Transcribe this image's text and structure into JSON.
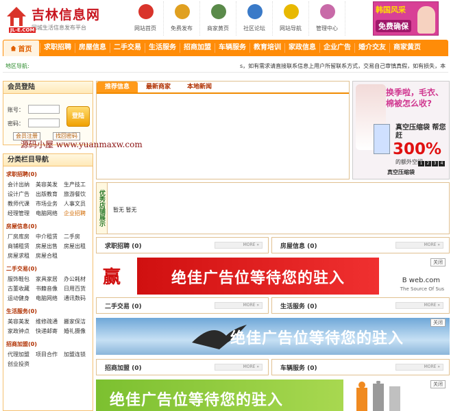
{
  "logo": {
    "title": "吉林信息网",
    "slogan": "同城生活信息发布平台",
    "domain": "JL-E.COM"
  },
  "topnav": [
    {
      "label": "网站首页",
      "icon": "house-icon",
      "color": "#d9342b"
    },
    {
      "label": "免费发布",
      "icon": "document-icon",
      "color": "#e0a020"
    },
    {
      "label": "商家黄页",
      "icon": "id-card-icon",
      "color": "#5a8a4a"
    },
    {
      "label": "社区论坛",
      "icon": "people-icon",
      "color": "#3a7ac8"
    },
    {
      "label": "网站导航",
      "icon": "star-icon",
      "color": "#e8b800"
    },
    {
      "label": "管理中心",
      "icon": "users-icon",
      "color": "#c86aa8"
    }
  ],
  "ad_top": {
    "line1": "韩国风采",
    "line2": "免费确保"
  },
  "nav": {
    "home": "首页",
    "items": [
      "求职招聘",
      "房屋信息",
      "二手交易",
      "生活服务",
      "招商加盟",
      "车辆服务",
      "教育培训",
      "家政信息",
      "企业广告",
      "婚介交友",
      "商家黄页"
    ]
  },
  "marquee": {
    "label": "地区导航:",
    "text": "s，如有需求请直接联系信息上用户所留联系方式，交易自己审慎真假，如有损失，本"
  },
  "login": {
    "title": "会员登陆",
    "user_label": "账号：",
    "pass_label": "密码：",
    "submit": "登陆",
    "register": "会员注册",
    "forgot": "找回密码"
  },
  "watermark": "源码小屋 www.yuanmaxw.com",
  "categories": {
    "title": "分类栏目导航",
    "groups": [
      {
        "name": "求职招聘(0)",
        "items": [
          "会计出纳",
          "美容美发",
          "生产技工",
          "设计广告",
          "出版教育",
          "旅游餐饮",
          "教师代课",
          "市场业务",
          "人事文员",
          "经理管理",
          "电脑网络",
          "企业招聘"
        ]
      },
      {
        "name": "房屋信息(0)",
        "items": [
          "厂房库房",
          "中介租赁",
          "二手房",
          "商铺租赁",
          "房屋出售",
          "房屋出租",
          "房屋求租",
          "房屋合租"
        ]
      },
      {
        "name": "二手交易(0)",
        "items": [
          "服饰鞋包",
          "家具家居",
          "办公耗材",
          "古董收藏",
          "书籍音像",
          "日用百货",
          "运动健身",
          "电脑网络",
          "通讯数码"
        ]
      },
      {
        "name": "生活服务(0)",
        "items": [
          "美容美发",
          "维修疏通",
          "搬家保洁",
          "家政钟点",
          "快递邮寄",
          "婚礼摄像"
        ]
      },
      {
        "name": "招商加盟(0)",
        "items": [
          "代理加盟",
          "项目合作",
          "加盟连锁",
          "创业投资"
        ]
      }
    ]
  },
  "tabs": [
    "推荐信息",
    "最新商家",
    "本地新闻"
  ],
  "right_ad": {
    "question": "换季啦，毛衣、棉被怎么收?",
    "t1": "真空压缩袋 帮您赶",
    "big": "300%",
    "t2": "的额外空间",
    "caption": "真空压缩袋",
    "pages": [
      "1",
      "2",
      "3",
      "4"
    ]
  },
  "shop": {
    "title": "优秀店铺展示",
    "values": "暂无  暂无"
  },
  "sections": [
    {
      "title": "求职招聘 (0)",
      "more": "MORE »"
    },
    {
      "title": "房屋信息 (0)",
      "more": "MORE »"
    },
    {
      "title": "二手交易 (0)",
      "more": "MORE »"
    },
    {
      "title": "生活服务 (0)",
      "more": "MORE »"
    },
    {
      "title": "招商加盟 (0)",
      "more": "MORE »"
    },
    {
      "title": "车辆服务 (0)",
      "more": "MORE »"
    }
  ],
  "banners": [
    {
      "text": "绝佳广告位等待您的驻入",
      "close": "关闭",
      "brand": "B   web.com",
      "note": "The Source Of Sus",
      "lead": "赢"
    },
    {
      "text": "绝佳广告位等待您的驻入",
      "close": "关闭"
    },
    {
      "text": "绝佳广告位等待您的驻入",
      "close": "关闭"
    }
  ]
}
